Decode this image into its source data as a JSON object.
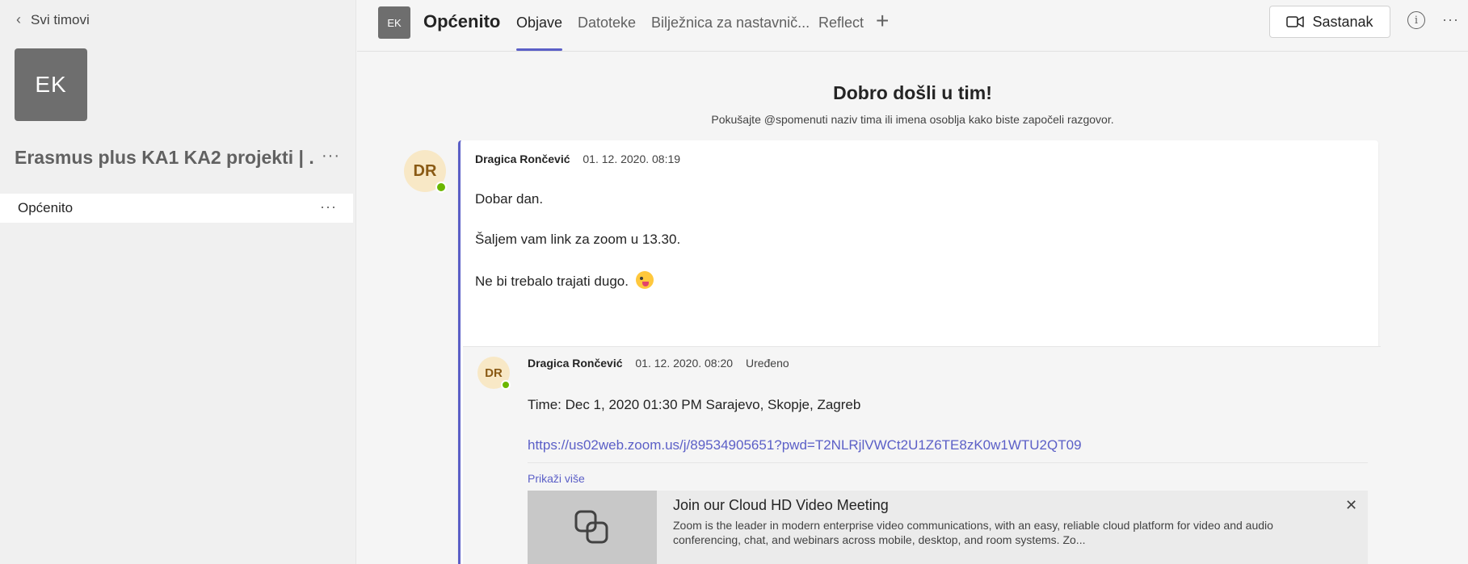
{
  "sidebar": {
    "back_label": "Svi timovi",
    "team_initials": "EK",
    "team_name": "Erasmus plus KA1 KA2 projekti | ...",
    "more": "···",
    "channels": [
      {
        "label": "Općenito",
        "more": "···"
      }
    ]
  },
  "header": {
    "channel_initials": "EK",
    "channel_title": "Općenito",
    "tabs": [
      {
        "label": "Objave",
        "active": true
      },
      {
        "label": "Datoteke",
        "active": false
      },
      {
        "label": "Bilježnica za nastavnič...",
        "active": false
      },
      {
        "label": "Reflect",
        "active": false
      }
    ],
    "add_tab": "+",
    "meet_label": "Sastanak",
    "info": "i",
    "more": "···"
  },
  "welcome": {
    "title": "Dobro došli u tim!",
    "subtitle": "Pokušajte @spomenuti naziv tima ili imena osoblja kako biste započeli razgovor."
  },
  "post": {
    "avatar_initials": "DR",
    "author": "Dragica Rončević",
    "timestamp": "01. 12. 2020. 08:19",
    "lines": [
      "Dobar dan.",
      "Šaljem vam link za zoom u 13.30.",
      "Ne bi trebalo trajati dugo."
    ],
    "reply": {
      "avatar_initials": "DR",
      "author": "Dragica Rončević",
      "timestamp": "01. 12. 2020. 08:20",
      "edited": "Uređeno",
      "time_line": "Time: Dec 1, 2020 01:30 PM Sarajevo, Skopje, Zagreb",
      "link": "https://us02web.zoom.us/j/89534905651?pwd=T2NLRjlVWCt2U1Z6TE8zK0w1WTU2QT09",
      "show_more": "Prikaži više",
      "card": {
        "title": "Join our Cloud HD Video Meeting",
        "description": "Zoom is the leader in modern enterprise video communications, with an easy, reliable cloud platform for video and audio conferencing, chat, and webinars across mobile, desktop, and room systems. Zo..."
      }
    }
  },
  "colors": {
    "accent": "#5b5fc7",
    "presence": "#6bb700",
    "avatar_bg": "#f8e8c6"
  }
}
